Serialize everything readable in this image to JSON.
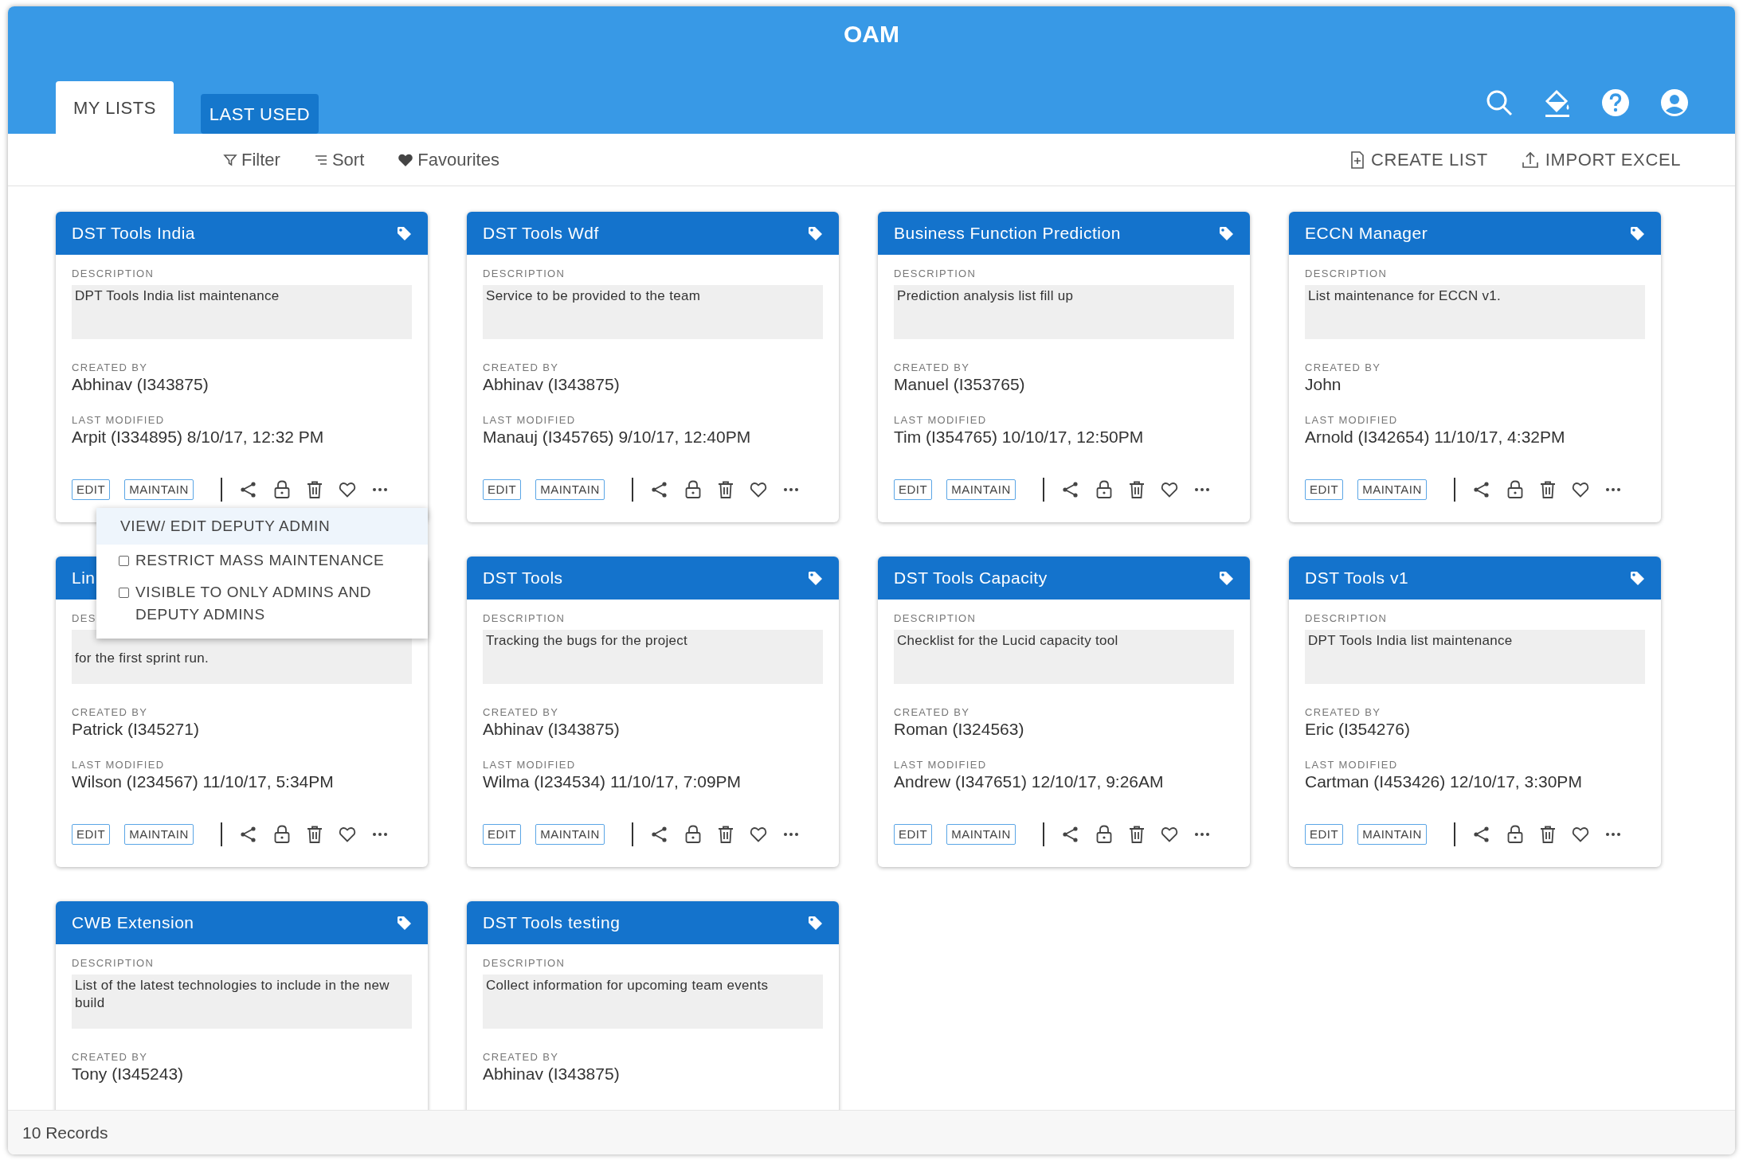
{
  "app": {
    "title": "OAM"
  },
  "tabs": [
    {
      "label": "MY LISTS",
      "selected": true
    },
    {
      "label": "LAST USED",
      "selected": false
    }
  ],
  "toolbar": {
    "filters": [
      {
        "label": "Filter",
        "kind": "filter"
      },
      {
        "label": "Sort",
        "kind": "sort"
      },
      {
        "label": "Favourites",
        "kind": "favourites"
      }
    ],
    "actions": [
      {
        "label": "CREATE LIST",
        "kind": "create"
      },
      {
        "label": "IMPORT EXCEL",
        "kind": "import"
      }
    ]
  },
  "cards": [
    {
      "title": "DST Tools India",
      "description_label": "DESCRIPTION",
      "description": "DPT Tools India list maintenance",
      "created_by_label": "CREATED BY",
      "created_by": "Abhinav (I343875)",
      "last_modified_label": "LAST MODIFIED",
      "last_modified": "Arpit (I334895) 8/10/17, 12:32 PM",
      "buttons": [
        "EDIT",
        "MAINTAIN"
      ],
      "menu": [
        {
          "label": "VIEW/ EDIT DEPUTY ADMIN",
          "kind": "action",
          "selected": true
        },
        {
          "label": "RESTRICT MASS MAINTENANCE",
          "kind": "checkbox",
          "checked": false,
          "selected": false
        },
        {
          "label": "VISIBLE TO ONLY ADMINS AND DEPUTY ADMINS",
          "kind": "checkbox",
          "checked": false,
          "selected": false
        }
      ]
    },
    {
      "title": "DST Tools Wdf",
      "description_label": "DESCRIPTION",
      "description": "Service to be provided to the team",
      "created_by_label": "CREATED BY",
      "created_by": "Abhinav (I343875)",
      "last_modified_label": "LAST MODIFIED",
      "last_modified": "Manauj (I345765) 9/10/17, 12:40PM",
      "buttons": [
        "EDIT",
        "MAINTAIN"
      ]
    },
    {
      "title": "Business Function Prediction",
      "description_label": "DESCRIPTION",
      "description": "Prediction analysis list fill up",
      "created_by_label": "CREATED BY",
      "created_by": "Manuel (I353765)",
      "last_modified_label": "LAST MODIFIED",
      "last_modified": "Tim (I354765) 10/10/17, 12:50PM",
      "buttons": [
        "EDIT",
        "MAINTAIN"
      ]
    },
    {
      "title": "ECCN Manager",
      "description_label": "DESCRIPTION",
      "description": "List maintenance for ECCN v1.",
      "created_by_label": "CREATED BY",
      "created_by": "John",
      "last_modified_label": "LAST MODIFIED",
      "last_modified": "Arnold (I342654) 11/10/17, 4:32PM",
      "buttons": [
        "EDIT",
        "MAINTAIN"
      ]
    },
    {
      "title": "Lin",
      "description_label": "DES",
      "description_top_covered": true,
      "description": "for the first sprint run.",
      "created_by_label": "CREATED BY",
      "created_by": "Patrick (I345271)",
      "last_modified_label": "LAST MODIFIED",
      "last_modified": "Wilson (I234567) 11/10/17, 5:34PM",
      "buttons": [
        "EDIT",
        "MAINTAIN"
      ]
    },
    {
      "title": "DST Tools",
      "description_label": "DESCRIPTION",
      "description": "Tracking the bugs for the project",
      "created_by_label": "CREATED BY",
      "created_by": "Abhinav (I343875)",
      "last_modified_label": "LAST MODIFIED",
      "last_modified": "Wilma (I234534) 11/10/17, 7:09PM",
      "buttons": [
        "EDIT",
        "MAINTAIN"
      ]
    },
    {
      "title": "DST Tools Capacity",
      "description_label": "DESCRIPTION",
      "description": "Checklist for the Lucid capacity tool",
      "created_by_label": "CREATED BY",
      "created_by": "Roman (I324563)",
      "last_modified_label": "LAST MODIFIED",
      "last_modified": "Andrew (I347651) 12/10/17, 9:26AM",
      "buttons": [
        "EDIT",
        "MAINTAIN"
      ]
    },
    {
      "title": "DST Tools v1",
      "description_label": "DESCRIPTION",
      "description": "DPT Tools India list maintenance",
      "created_by_label": "CREATED BY",
      "created_by": "Eric (I354276)",
      "last_modified_label": "LAST MODIFIED",
      "last_modified": "Cartman (I453426) 12/10/17, 3:30PM",
      "buttons": [
        "EDIT",
        "MAINTAIN"
      ]
    },
    {
      "title": "CWB Extension",
      "description_label": "DESCRIPTION",
      "description": "List of the latest technologies to include in the new build",
      "created_by_label": "CREATED BY",
      "created_by": "Tony (I345243)"
    },
    {
      "title": "DST Tools testing",
      "description_label": "DESCRIPTION",
      "description": "Collect information for upcoming team events",
      "created_by_label": "CREATED BY",
      "created_by": "Abhinav (I343875)"
    }
  ],
  "status_bar": {
    "records": "10 Records"
  }
}
